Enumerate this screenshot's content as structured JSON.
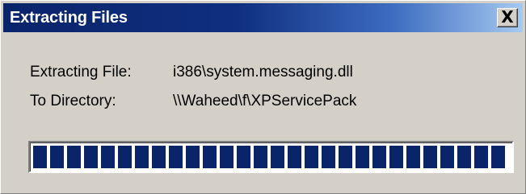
{
  "window": {
    "title": "Extracting Files",
    "close_glyph": "X",
    "close_icon": "close-icon"
  },
  "details": {
    "file_label": "Extracting File:",
    "file_value": "i386\\system.messaging.dll",
    "dir_label": "To Directory:",
    "dir_value": "\\\\Waheed\\f\\XPServicePack"
  },
  "progress": {
    "percent": 100,
    "bar_color": "#0a246a"
  },
  "colors": {
    "titlebar_start": "#0a246a",
    "titlebar_end": "#a6caf0",
    "face": "#d4d0c8"
  }
}
